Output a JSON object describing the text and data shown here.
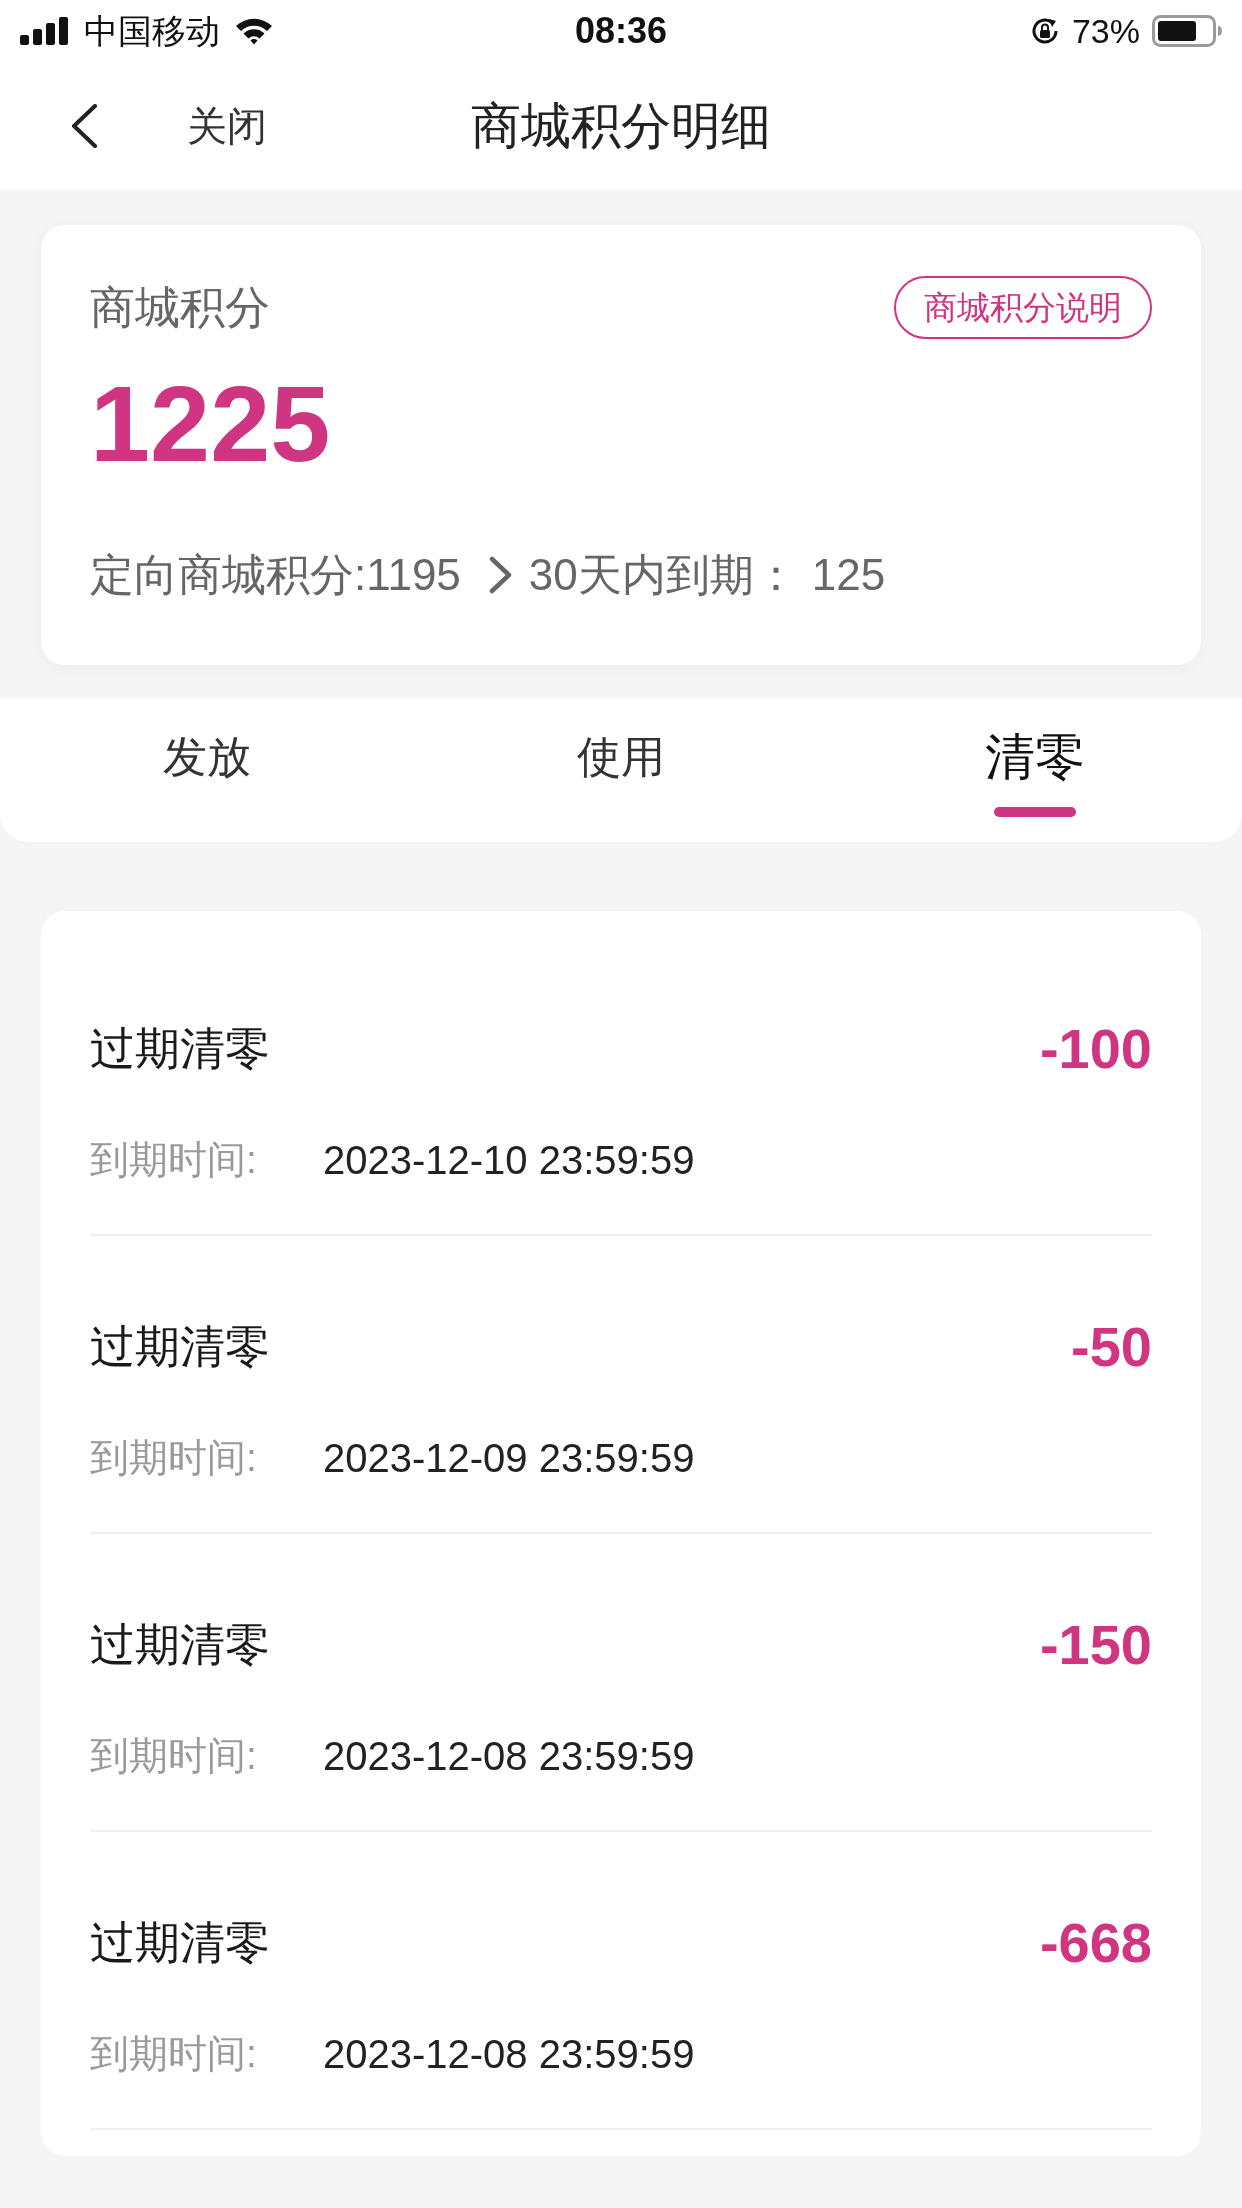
{
  "status_bar": {
    "carrier": "中国移动",
    "time": "08:36",
    "battery": "73%"
  },
  "nav": {
    "close": "关闭",
    "title": "商城积分明细"
  },
  "summary": {
    "label": "商城积分",
    "info_button": "商城积分说明",
    "total": "1225",
    "targeted": "定向商城积分:1195",
    "expiring_label": "30天内到期：",
    "expiring_value": "125"
  },
  "tabs": [
    {
      "label": "发放",
      "selected": false
    },
    {
      "label": "使用",
      "selected": false
    },
    {
      "label": "清零",
      "selected": true
    }
  ],
  "records": [
    {
      "title": "过期清零",
      "amount": "-100",
      "date_label": "到期时间:",
      "date": "2023-12-10 23:59:59"
    },
    {
      "title": "过期清零",
      "amount": "-50",
      "date_label": "到期时间:",
      "date": "2023-12-09 23:59:59"
    },
    {
      "title": "过期清零",
      "amount": "-150",
      "date_label": "到期时间:",
      "date": "2023-12-08 23:59:59"
    },
    {
      "title": "过期清零",
      "amount": "-668",
      "date_label": "到期时间:",
      "date": "2023-12-08 23:59:59"
    }
  ]
}
